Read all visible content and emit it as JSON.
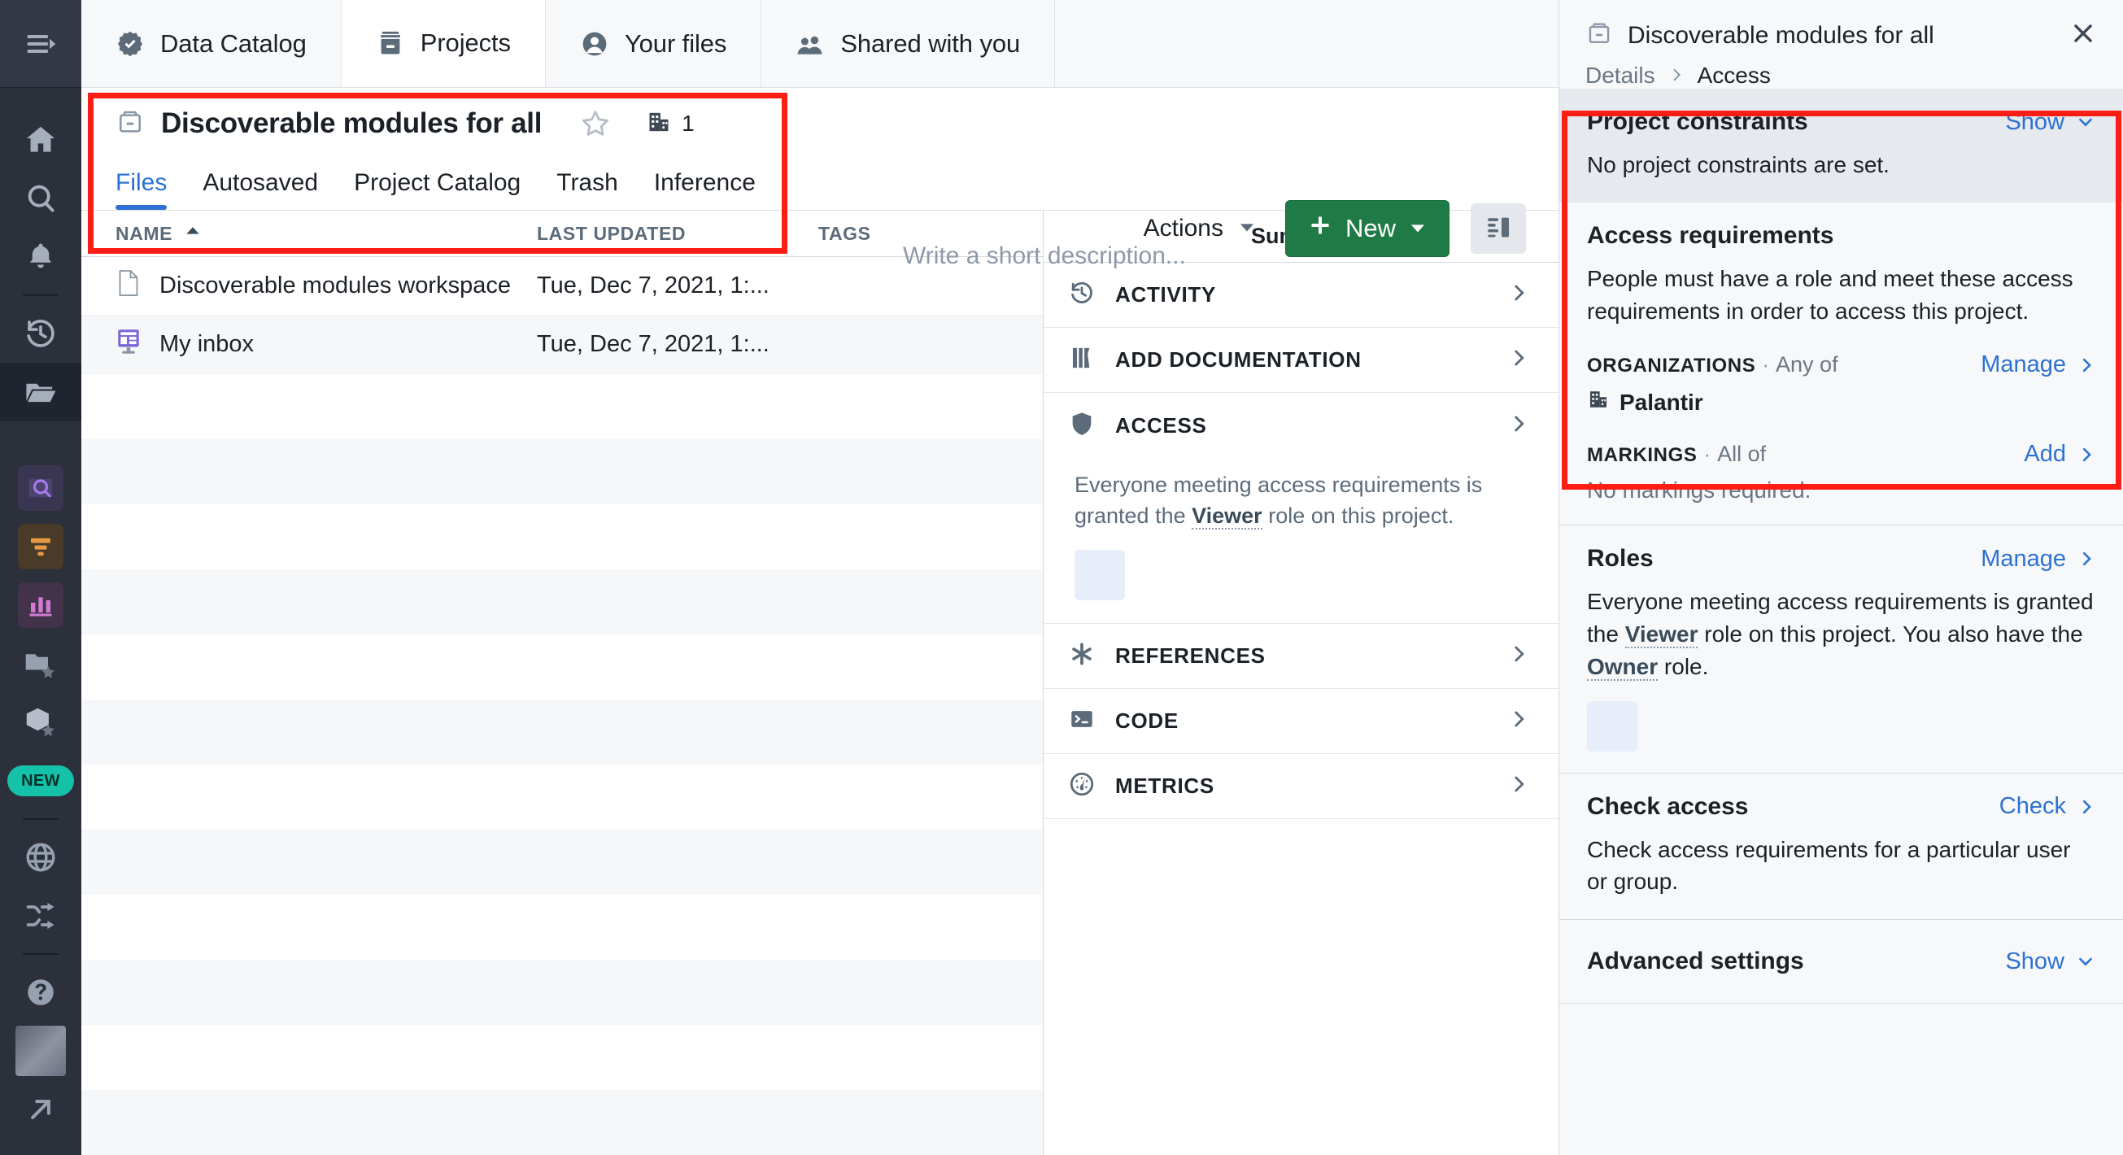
{
  "rail": {
    "items": [
      {
        "name": "menu-expand-icon",
        "label": "Expand menu"
      },
      {
        "name": "home-icon",
        "label": "Home"
      },
      {
        "name": "search-icon",
        "label": "Search"
      },
      {
        "name": "notifications-bell-icon",
        "label": "Notifications"
      },
      {
        "name": "history-icon",
        "label": "Recent"
      },
      {
        "name": "folder-open-icon",
        "label": "Projects"
      },
      {
        "name": "app-search-icon",
        "label": "Object Explorer"
      },
      {
        "name": "app-filter-icon",
        "label": "Pipeline Builder"
      },
      {
        "name": "app-chart-icon",
        "label": "Quiver"
      },
      {
        "name": "folder-star-icon",
        "label": "Favorite projects"
      },
      {
        "name": "cube-star-icon",
        "label": "Favorite objects"
      },
      {
        "name": "new-badge",
        "label": "NEW"
      },
      {
        "name": "globe-icon",
        "label": "Map"
      },
      {
        "name": "shuffle-icon",
        "label": "Shuffle"
      },
      {
        "name": "help-icon",
        "label": "Help"
      },
      {
        "name": "avatar",
        "label": "Account"
      },
      {
        "name": "open-external-icon",
        "label": "Open in new tab"
      }
    ],
    "new_badge_label": "NEW"
  },
  "top_tabs": [
    {
      "label": "Data Catalog",
      "icon": "verified-badge-icon",
      "active": false
    },
    {
      "label": "Projects",
      "icon": "archive-box-icon",
      "active": true
    },
    {
      "label": "Your files",
      "icon": "user-circle-icon",
      "active": false
    },
    {
      "label": "Shared with you",
      "icon": "people-icon",
      "active": false
    }
  ],
  "project": {
    "title": "Discoverable modules for all",
    "icon": "archive-box-icon",
    "starred": false,
    "org_count": "1",
    "description_placeholder": "Write a short description...",
    "tabs": [
      {
        "label": "Files",
        "active": true
      },
      {
        "label": "Autosaved",
        "active": false
      },
      {
        "label": "Project Catalog",
        "active": false
      },
      {
        "label": "Trash",
        "active": false
      },
      {
        "label": "Inference",
        "active": false
      }
    ],
    "actions_label": "Actions",
    "new_label": "New"
  },
  "file_table": {
    "columns": [
      "NAME",
      "LAST UPDATED",
      "TAGS"
    ],
    "sort_column": "NAME",
    "sort_direction": "asc",
    "rows": [
      {
        "name": "Discoverable modules workspace",
        "icon": "document-icon",
        "last_updated": "Tue, Dec 7, 2021, 1:...",
        "tags": ""
      },
      {
        "name": "My inbox",
        "icon": "inbox-app-icon",
        "last_updated": "Tue, Dec 7, 2021, 1:...",
        "tags": ""
      }
    ]
  },
  "summary": {
    "title": "Summary",
    "sections": [
      {
        "label": "ACTIVITY",
        "icon": "history-icon"
      },
      {
        "label": "ADD DOCUMENTATION",
        "icon": "book-icon"
      },
      {
        "label": "ACCESS",
        "icon": "shield-icon"
      },
      {
        "label": "REFERENCES",
        "icon": "asterisk-icon"
      },
      {
        "label": "CODE",
        "icon": "terminal-icon"
      },
      {
        "label": "METRICS",
        "icon": "gauge-icon"
      }
    ],
    "access_text_before": "Everyone meeting access requirements is granted the ",
    "access_role": "Viewer",
    "access_text_after": " role on this project."
  },
  "right_panel": {
    "title": "Discoverable modules for all",
    "title_icon": "archive-box-icon",
    "close_icon": "close-icon",
    "breadcrumb": {
      "parent": "Details",
      "current": "Access"
    },
    "project_constraints": {
      "title": "Project constraints",
      "toggle_label": "Show",
      "body": "No project constraints are set."
    },
    "access_requirements": {
      "title": "Access requirements",
      "body": "People must have a role and meet these access requirements in order to access this project.",
      "organizations": {
        "key": "ORGANIZATIONS",
        "mode": "Any of",
        "action": "Manage",
        "value": "Palantir",
        "value_icon": "building-icon"
      },
      "markings": {
        "key": "MARKINGS",
        "mode": "All of",
        "action": "Add",
        "empty": "No markings required."
      }
    },
    "roles": {
      "title": "Roles",
      "action": "Manage",
      "text_1": "Everyone meeting access requirements is granted the ",
      "role_1": "Viewer",
      "text_2": " role on this project. You also have the ",
      "role_2": "Owner",
      "text_3": " role."
    },
    "check_access": {
      "title": "Check access",
      "action": "Check",
      "body": "Check access requirements for a particular user or group."
    },
    "advanced_settings": {
      "title": "Advanced settings",
      "toggle_label": "Show"
    }
  },
  "colors": {
    "accent_blue": "#2d72d2",
    "green_button": "#1f7a45",
    "annotation_red": "#fc1d15",
    "rail_bg": "#2b303b",
    "new_badge": "#15c1a8"
  }
}
